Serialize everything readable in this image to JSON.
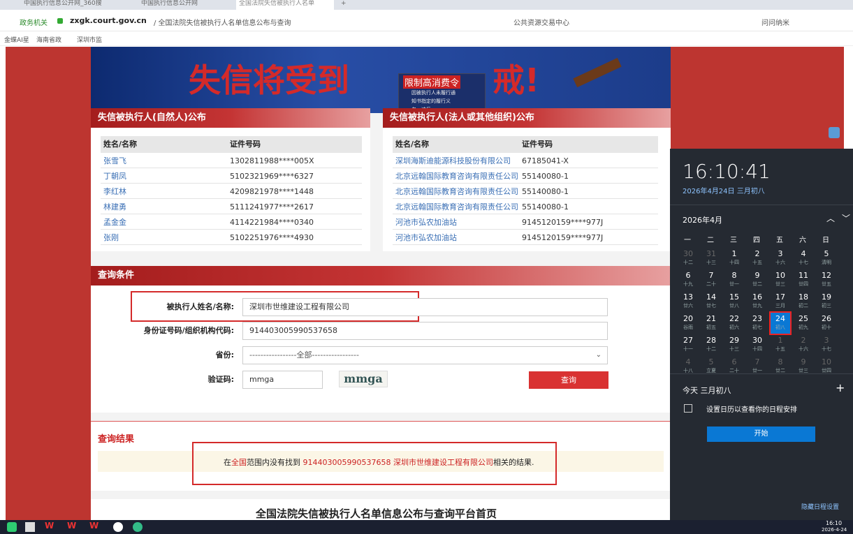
{
  "browser": {
    "tabs": [
      "中国执行信息公开网_360搜",
      "中国执行信息公开网",
      "全国法院失信被执行人名单"
    ],
    "address": {
      "prefix": "政务机关",
      "domain": "zxgk.court.gov.cn",
      "path": "/ 全国法院失信被执行人名单信息公布与查询"
    },
    "search_placeholder": "公共资源交易中心",
    "right_link": "问问纳米",
    "favorites": [
      "金蝶AI星",
      "海南省政",
      "深圳市监"
    ]
  },
  "banner": {
    "title": "失信将受到",
    "title_tail": "戒!",
    "overlay_title": "限制高消费令",
    "overlay_lines": [
      "因被执行人未履行通",
      "知书指定的履行义",
      "务，违反…"
    ]
  },
  "panel_person": {
    "title": "失信被执行人(自然人)公布",
    "col_name": "姓名/名称",
    "col_id": "证件号码",
    "rows": [
      {
        "name": "张雪飞",
        "id": "1302811988****005X"
      },
      {
        "name": "丁朝凤",
        "id": "5102321969****6327"
      },
      {
        "name": "李红林",
        "id": "4209821978****1448"
      },
      {
        "name": "林建勇",
        "id": "5111241977****2617"
      },
      {
        "name": "孟金金",
        "id": "4114221984****0340"
      },
      {
        "name": "张刚",
        "id": "5102251976****4930"
      }
    ]
  },
  "panel_org": {
    "title": "失信被执行人(法人或其他组织)公布",
    "col_name": "姓名/名称",
    "col_id": "证件号码",
    "rows": [
      {
        "name": "深圳海斯迪能源科技股份有限公司",
        "id": "67185041-X"
      },
      {
        "name": "北京远翰国际教育咨询有限责任公司",
        "id": "55140080-1"
      },
      {
        "name": "北京远翰国际教育咨询有限责任公司",
        "id": "55140080-1"
      },
      {
        "name": "北京远翰国际教育咨询有限责任公司",
        "id": "55140080-1"
      },
      {
        "name": "河池市弘农加油站",
        "id": "9145120159****977J"
      },
      {
        "name": "河池市弘农加油站",
        "id": "9145120159****977J"
      }
    ]
  },
  "query": {
    "title": "查询条件",
    "name_label": "被执行人姓名/名称:",
    "name_value": "深圳市世维建设工程有限公司",
    "id_label": "身份证号码/组织机构代码:",
    "id_value": "914403005990537658",
    "province_label": "省份:",
    "province_value": "-----------------全部-----------------",
    "captcha_label": "验证码:",
    "captcha_value": "mmga",
    "captcha_image_text": "mmga",
    "submit": "查询"
  },
  "result": {
    "title": "查询结果",
    "prefix": "在",
    "scope": "全国",
    "mid": "范围内没有找到 ",
    "code": "914403005990537658",
    "company": "深圳市世维建设工程有限公司",
    "suffix": "相关的结果."
  },
  "footer_title": "全国法院失信被执行人名单信息公布与查询平台首页",
  "calendar": {
    "time": "16:10:41",
    "date": "2026年4月24日 三月初八",
    "month": "2026年4月",
    "weekdays": [
      "一",
      "二",
      "三",
      "四",
      "五",
      "六",
      "日"
    ],
    "days": [
      [
        "30",
        "十二"
      ],
      [
        "31",
        "十三"
      ],
      [
        "1",
        "十四"
      ],
      [
        "2",
        "十五"
      ],
      [
        "3",
        "十六"
      ],
      [
        "4",
        "十七"
      ],
      [
        "5",
        "清明"
      ],
      [
        "6",
        "十九"
      ],
      [
        "7",
        "二十"
      ],
      [
        "8",
        "廿一"
      ],
      [
        "9",
        "廿二"
      ],
      [
        "10",
        "廿三"
      ],
      [
        "11",
        "廿四"
      ],
      [
        "12",
        "廿五"
      ],
      [
        "13",
        "廿六"
      ],
      [
        "14",
        "廿七"
      ],
      [
        "15",
        "廿八"
      ],
      [
        "16",
        "廿九"
      ],
      [
        "17",
        "三月"
      ],
      [
        "18",
        "初二"
      ],
      [
        "19",
        "初三"
      ],
      [
        "20",
        "谷雨"
      ],
      [
        "21",
        "初五"
      ],
      [
        "22",
        "初六"
      ],
      [
        "23",
        "初七"
      ],
      [
        "24",
        "初八"
      ],
      [
        "25",
        "初九"
      ],
      [
        "26",
        "初十"
      ],
      [
        "27",
        "十一"
      ],
      [
        "28",
        "十二"
      ],
      [
        "29",
        "十三"
      ],
      [
        "30",
        "十四"
      ],
      [
        "1",
        "十五"
      ],
      [
        "2",
        "十六"
      ],
      [
        "3",
        "十七"
      ],
      [
        "4",
        "十八"
      ],
      [
        "5",
        "立夏"
      ],
      [
        "6",
        "二十"
      ],
      [
        "7",
        "廿一"
      ],
      [
        "8",
        "廿二"
      ],
      [
        "9",
        "廿三"
      ],
      [
        "10",
        "廿四"
      ]
    ],
    "today_label": "今天 三月初八",
    "schedule_text": "设置日历以查看你的日程安排",
    "start_button": "开始",
    "hide_link": "隐藏日程设置"
  },
  "taskbar": {
    "time": "16:10",
    "date": "2026-4-24"
  },
  "colors": {
    "accent_red": "#bd3530",
    "link_blue": "#3a6fb5",
    "calendar_bg": "#252a32",
    "calendar_blue": "#0a78d4"
  }
}
